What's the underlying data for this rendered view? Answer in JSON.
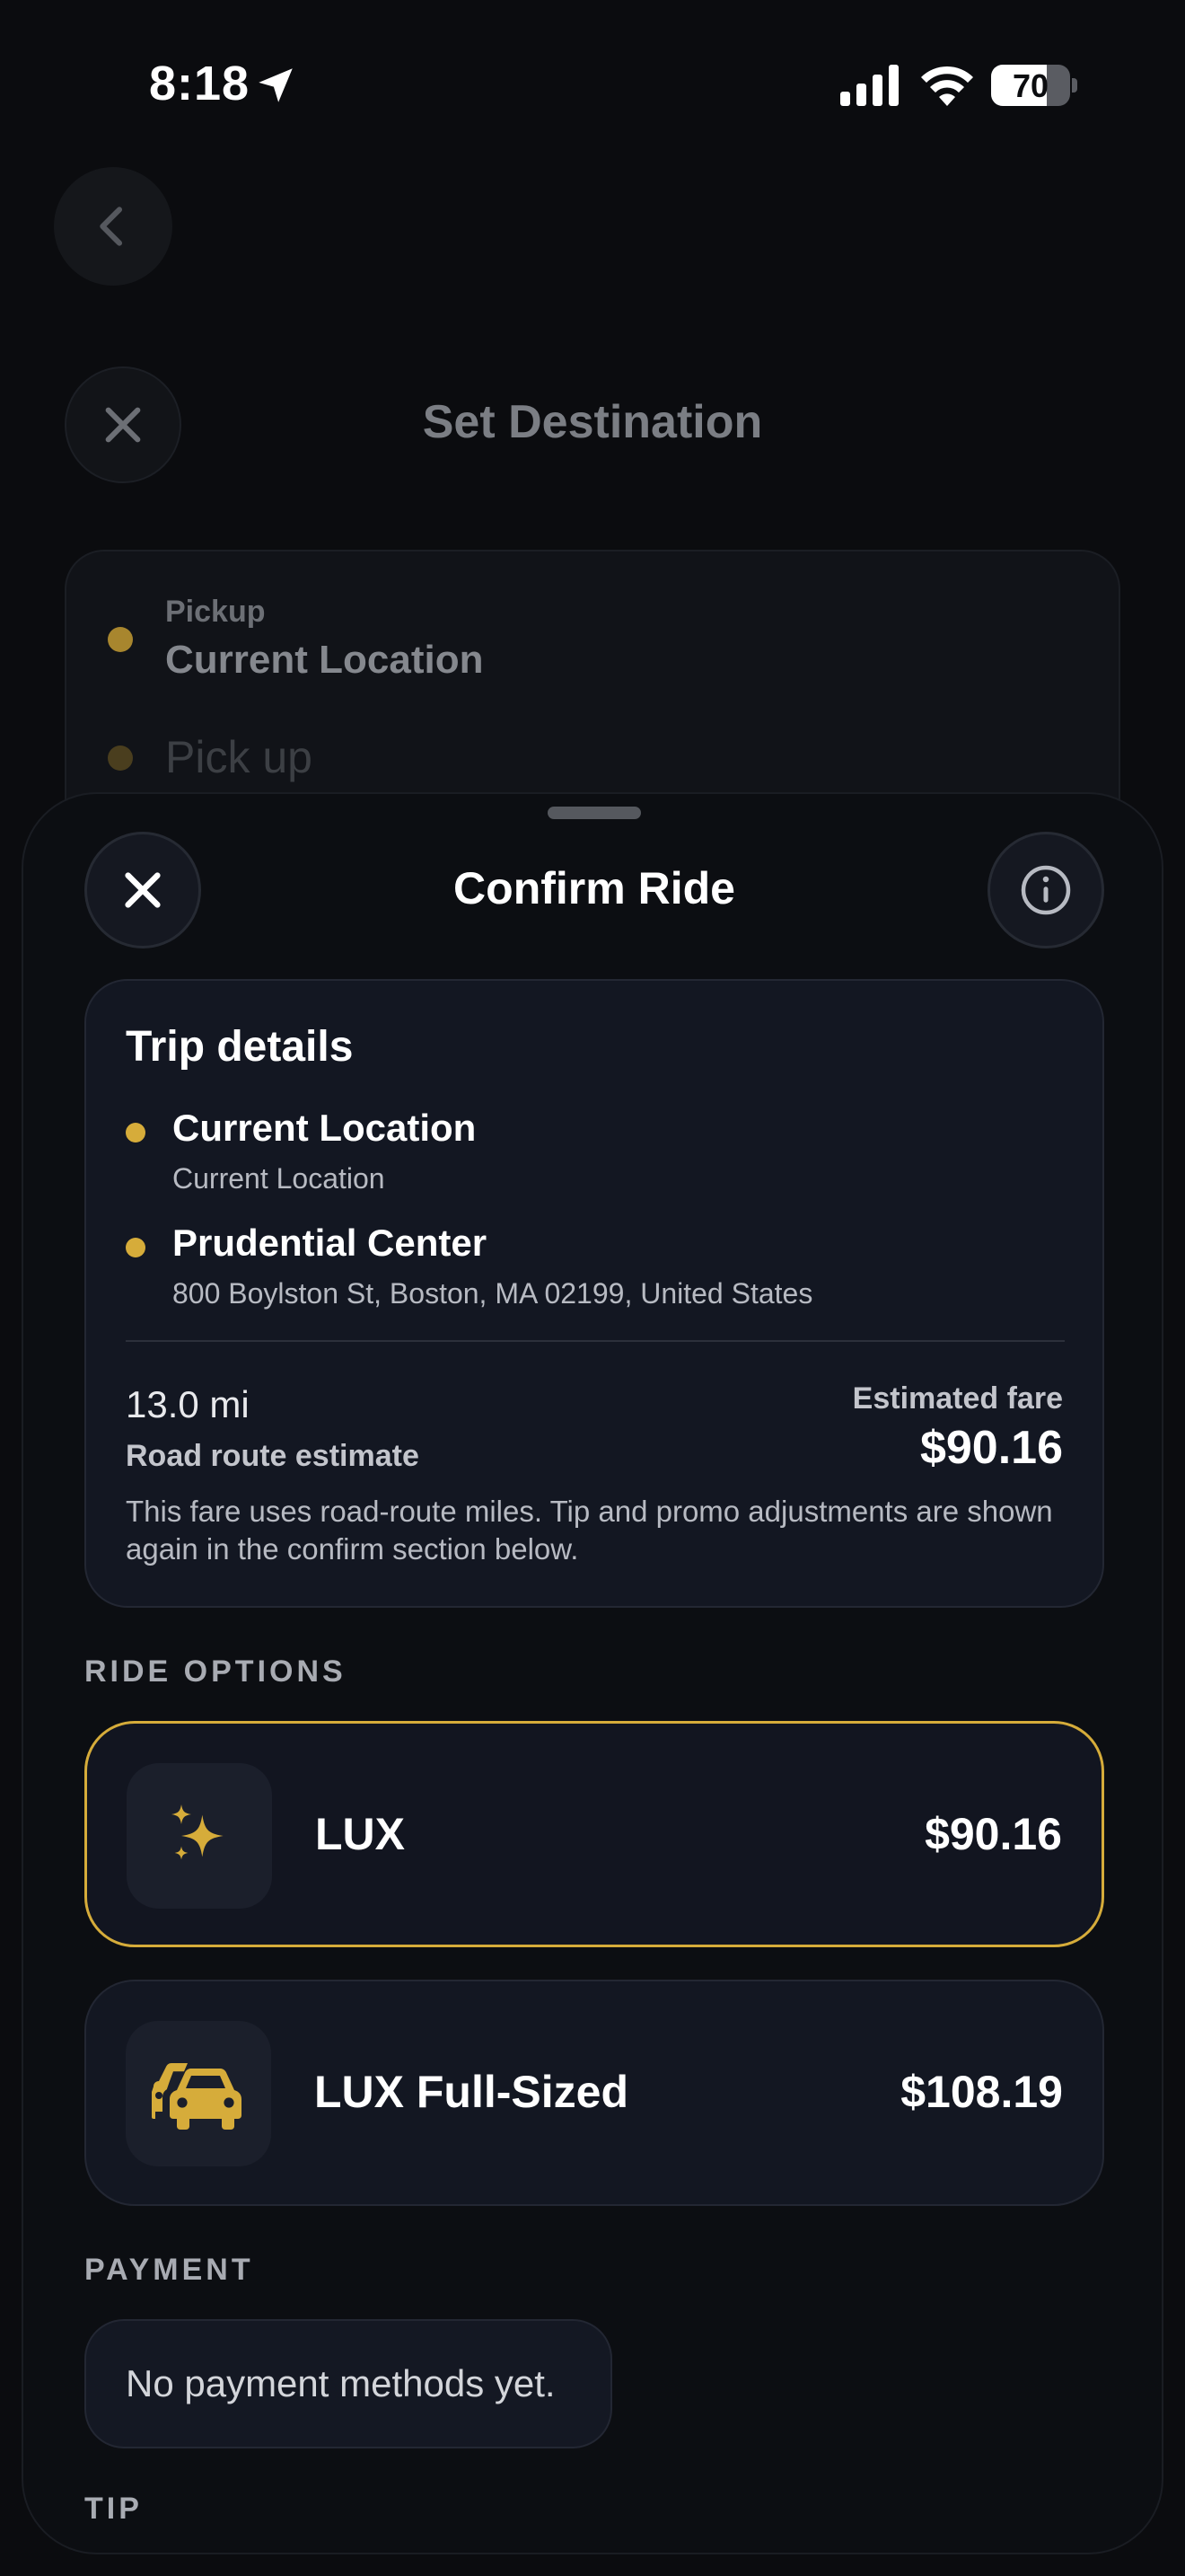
{
  "status_bar": {
    "time": "8:18",
    "battery_percent": "70",
    "battery_level": 0.7
  },
  "background": {
    "title": "Set Destination",
    "pickup_label": "Pickup",
    "pickup_value": "Current Location",
    "pickup_placeholder": "Pick up"
  },
  "sheet": {
    "title": "Confirm Ride",
    "trip": {
      "heading": "Trip details",
      "stops": [
        {
          "name": "Current Location",
          "address": "Current Location"
        },
        {
          "name": "Prudential Center",
          "address": "800 Boylston St, Boston, MA 02199, United States"
        }
      ],
      "distance": "13.0 mi",
      "distance_label": "Road route estimate",
      "fare_label": "Estimated fare",
      "fare": "$90.16",
      "note": "This fare uses road-route miles. Tip and promo adjustments are shown again in the confirm section below."
    },
    "ride_options_label": "RIDE OPTIONS",
    "options": [
      {
        "name": "LUX",
        "price": "$90.16",
        "icon": "sparkles-icon",
        "selected": true
      },
      {
        "name": "LUX Full-Sized",
        "price": "$108.19",
        "icon": "cars-icon",
        "selected": false
      }
    ],
    "payment_label": "PAYMENT",
    "payment_empty": "No payment methods yet.",
    "tip_label": "TIP"
  },
  "colors": {
    "accent": "#d6ac3a",
    "background": "#0b0c0f",
    "card": "#131722"
  }
}
